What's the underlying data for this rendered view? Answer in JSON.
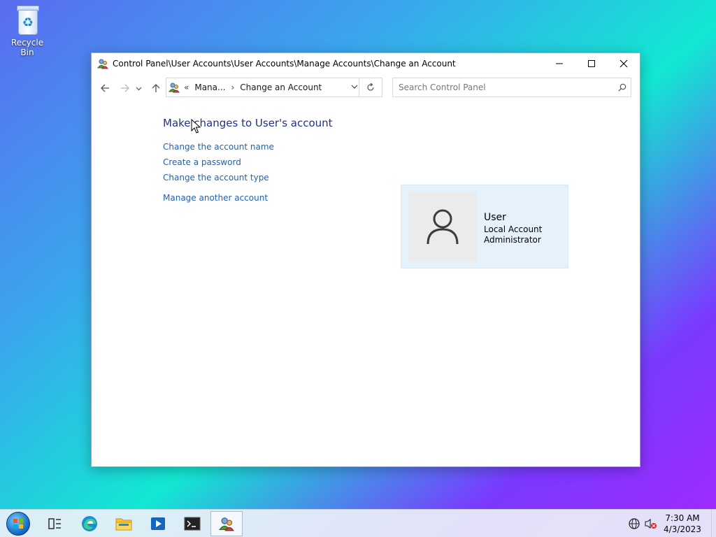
{
  "desktop": {
    "icons": [
      {
        "label": "Recycle Bin",
        "icon": "recycle-bin-icon"
      }
    ]
  },
  "window": {
    "title": "Control Panel\\User Accounts\\User Accounts\\Manage Accounts\\Change an Account",
    "controls": {
      "minimize": "minimize-icon",
      "maximize": "maximize-icon",
      "close": "close-icon"
    }
  },
  "navigation": {
    "back": "back-arrow-icon",
    "forward": "forward-arrow-icon",
    "recent": "chevron-down-icon",
    "up": "up-arrow-icon",
    "address": {
      "overflow": "«",
      "segments": [
        "Mana...",
        "Change an Account"
      ],
      "separator": "›"
    },
    "search": {
      "placeholder": "Search Control Panel"
    }
  },
  "main": {
    "heading": "Make changes to User's account",
    "links": [
      "Change the account name",
      "Create a password",
      "Change the account type",
      "Manage another account"
    ],
    "account": {
      "name": "User",
      "type": "Local Account",
      "role": "Administrator"
    }
  },
  "taskbar": {
    "items": [
      "start-button",
      "task-view-icon",
      "edge-icon",
      "file-explorer-icon",
      "media-player-icon",
      "terminal-icon",
      "user-accounts-icon"
    ],
    "clock": {
      "time": "7:30 AM",
      "date": "4/3/2023"
    }
  },
  "colors": {
    "link": "#1f61b4",
    "heading": "#1e3287",
    "card": "#e5f1fb"
  }
}
